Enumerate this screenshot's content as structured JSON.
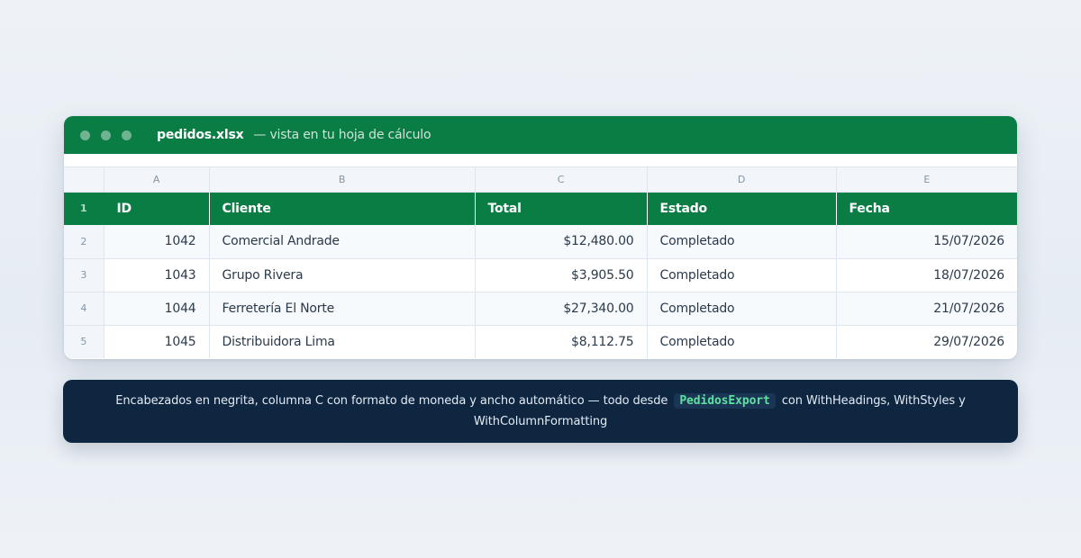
{
  "window": {
    "filename": "pedidos.xlsx",
    "subtitle": "— vista en tu hoja de cálculo"
  },
  "sheet": {
    "column_letters": [
      "A",
      "B",
      "C",
      "D",
      "E"
    ],
    "headers": [
      "ID",
      "Cliente",
      "Total",
      "Estado",
      "Fecha"
    ],
    "header_row_number": "1",
    "rows": [
      {
        "row": "2",
        "id": "1042",
        "cliente": "Comercial Andrade",
        "total": "$12,480.00",
        "estado": "Completado",
        "fecha": "15/07/2026"
      },
      {
        "row": "3",
        "id": "1043",
        "cliente": "Grupo Rivera",
        "total": "$3,905.50",
        "estado": "Completado",
        "fecha": "18/07/2026"
      },
      {
        "row": "4",
        "id": "1044",
        "cliente": "Ferretería El Norte",
        "total": "$27,340.00",
        "estado": "Completado",
        "fecha": "21/07/2026"
      },
      {
        "row": "5",
        "id": "1045",
        "cliente": "Distribuidora Lima",
        "total": "$8,112.75",
        "estado": "Completado",
        "fecha": "29/07/2026"
      }
    ]
  },
  "footer": {
    "text_before": "Encabezados en negrita, columna C con formato de moneda y ancho automático — todo desde",
    "code": "PedidosExport",
    "text_after": "con WithHeadings, WithStyles y WithColumnFormatting"
  },
  "colors": {
    "accent_green": "#0a7d44",
    "footer_navy": "#0e2640",
    "code_green": "#5ee0a1"
  }
}
